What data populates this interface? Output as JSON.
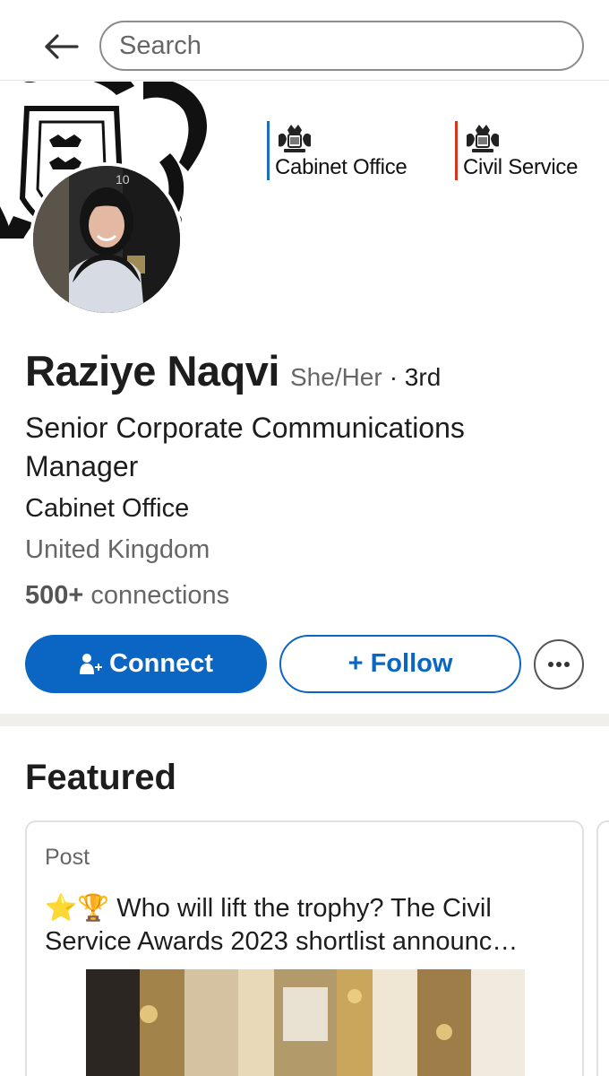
{
  "header": {
    "search_placeholder": "Search"
  },
  "banner": {
    "logos": [
      {
        "name": "Cabinet Office",
        "bar_color": "#1d70b8"
      },
      {
        "name": "Civil Service",
        "bar_color": "#d4351c"
      }
    ]
  },
  "profile": {
    "name": "Raziye Naqvi",
    "pronouns": "She/Her",
    "degree": "· 3rd",
    "headline": "Senior Corporate Communications Manager",
    "company": "Cabinet Office",
    "location": "United Kingdom",
    "connections_count": "500+",
    "connections_label": "connections"
  },
  "actions": {
    "connect_label": "Connect",
    "follow_label": "+ Follow"
  },
  "featured": {
    "title": "Featured",
    "items": [
      {
        "type": "Post",
        "text": "⭐🏆 Who will lift the trophy? The Civil Service Awards 2023 shortlist announc…"
      }
    ]
  },
  "colors": {
    "accent": "#0a66c2",
    "divider": "#f1efea"
  },
  "icons": {
    "back": "back-arrow-icon",
    "connect": "add-person-icon",
    "more": "more-dots-icon"
  }
}
